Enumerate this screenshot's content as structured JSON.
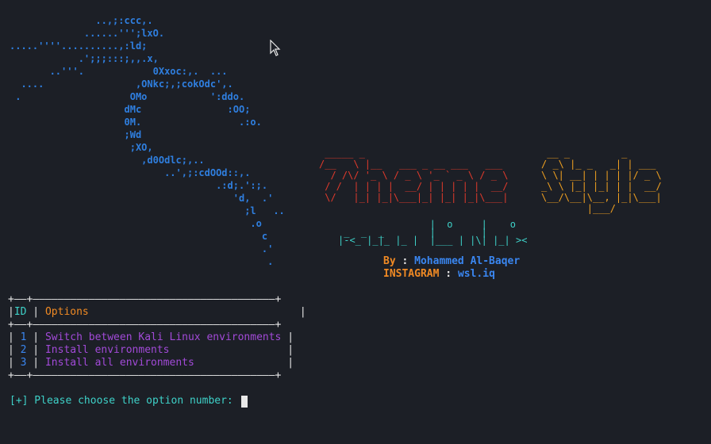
{
  "ascii_art": {
    "dragon": "               ..,;:ccc,.\n             ......''';lxO.\n.....''''..........,:ld;\n            .';;;:::;,,.x,\n       ..'''.            0Xxoc:,.  ...\n  ....                ,ONkc;,;cokOdc',.\n .                   OMo           ':ddo.\n                    dMc               :OO;\n                    0M.                 .:o.\n                    ;Wd\n                     ;XO,\n                       ,d0Odlc;,..\n                           ..',;:cdOOd::,.\n                                    .:d;.':;.\n                                       'd,  .'\n                                         ;l   ..\n                                          .o\n                                            c\n                                            .'\n                                             .",
    "theme": " _____ _\n/__   \\ |__   ___ _ __ ___   ___\n  / /\\/ '_ \\ / _ \\ '_ ` _ \\ / _ \\\n / /  | | | |  __/ | | | | |  __/\n \\/   |_| |_|\\___|_| |_| |_|\\___|",
    "style": " __ _         _\n/ _\\ |_ _   _| | ___\n\\ \\| __| | | | |/ _ \\\n_\\ \\ |_| |_| | |  __/\n\\__/\\__|\\__, |_|\\___|\n        |___/",
    "tagline": "                |  o     |    o\n _  _  _        |        |\n|-<_ |_|_ |_ |  |___ | |\\| |_| ><"
  },
  "credits": {
    "by_label": "By",
    "by_sep": " : ",
    "by_value": "Mohammed Al-Baqer",
    "insta_label": "INSTAGRAM",
    "insta_sep": " : ",
    "insta_value": "wsl.iq"
  },
  "table": {
    "border_top": "+-----+--------------------------------------------+",
    "header_id": "ID",
    "header_options": "Options",
    "rows": [
      {
        "id": "1",
        "label": "Switch between Kali Linux environments"
      },
      {
        "id": "2",
        "label": "Install environments"
      },
      {
        "id": "3",
        "label": "Install all environments"
      }
    ]
  },
  "prompt": {
    "text": "[+] Please choose the option number: "
  },
  "colors": {
    "background": "#1c1f26",
    "dragon": "#2f7fe0",
    "theme": "#e03a2c",
    "style": "#f0a020",
    "teal": "#3ed1c8",
    "orange": "#f08a24",
    "purple": "#a24ad8",
    "blue": "#3a86f0"
  }
}
